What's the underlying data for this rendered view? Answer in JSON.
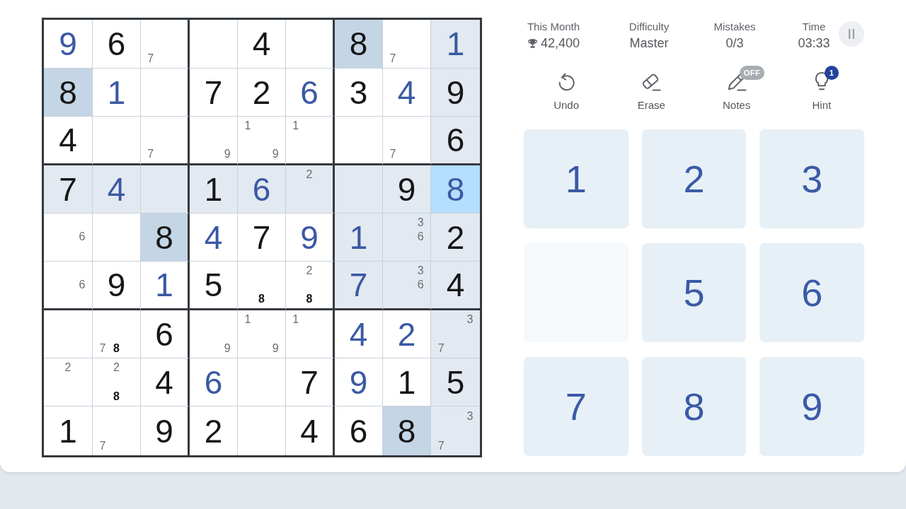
{
  "stats": [
    {
      "kind": "score",
      "label": "This Month",
      "value": "42,400"
    },
    {
      "kind": "plain",
      "label": "Difficulty",
      "value": "Master"
    },
    {
      "kind": "plain",
      "label": "Mistakes",
      "value": "0/3"
    },
    {
      "kind": "timer",
      "label": "Time",
      "value": "03:33"
    }
  ],
  "tools": [
    {
      "kind": "undo",
      "label": "Undo"
    },
    {
      "kind": "erase",
      "label": "Erase"
    },
    {
      "kind": "notes",
      "label": "Notes",
      "badge": "OFF"
    },
    {
      "kind": "hint",
      "label": "Hint",
      "badge": "1"
    }
  ],
  "numpad": [
    {
      "label": "1",
      "disabled": false
    },
    {
      "label": "2",
      "disabled": false
    },
    {
      "label": "3",
      "disabled": false
    },
    {
      "disabled": true
    },
    {
      "label": "5",
      "disabled": false
    },
    {
      "label": "6",
      "disabled": false
    },
    {
      "label": "7",
      "disabled": false
    },
    {
      "label": "8",
      "disabled": false
    },
    {
      "label": "9",
      "disabled": false
    }
  ],
  "board": {
    "rows": [
      {
        "cells": [
          {
            "kind": "entered",
            "value": "9",
            "selected": false,
            "same_number": false,
            "related": false
          },
          {
            "kind": "given",
            "value": "6",
            "selected": false,
            "same_number": false,
            "related": false
          },
          {
            "kind": "notes",
            "notes": [
              {
                "text": "7",
                "match": false
              }
            ],
            "selected": false,
            "same_number": false,
            "related": false
          },
          {
            "kind": "empty",
            "selected": false,
            "same_number": false,
            "related": false
          },
          {
            "kind": "given",
            "value": "4",
            "selected": false,
            "same_number": false,
            "related": false
          },
          {
            "kind": "empty",
            "selected": false,
            "same_number": false,
            "related": false
          },
          {
            "kind": "given",
            "value": "8",
            "selected": false,
            "same_number": true,
            "related": false
          },
          {
            "kind": "notes",
            "notes": [
              {
                "text": "7",
                "match": false
              }
            ],
            "selected": false,
            "same_number": false,
            "related": false
          },
          {
            "kind": "entered",
            "value": "1",
            "selected": false,
            "same_number": false,
            "related": true
          }
        ]
      },
      {
        "cells": [
          {
            "kind": "given",
            "value": "8",
            "selected": false,
            "same_number": true,
            "related": false
          },
          {
            "kind": "entered",
            "value": "1",
            "selected": false,
            "same_number": false,
            "related": false
          },
          {
            "kind": "empty",
            "selected": false,
            "same_number": false,
            "related": false
          },
          {
            "kind": "given",
            "value": "7",
            "selected": false,
            "same_number": false,
            "related": false
          },
          {
            "kind": "given",
            "value": "2",
            "selected": false,
            "same_number": false,
            "related": false
          },
          {
            "kind": "entered",
            "value": "6",
            "selected": false,
            "same_number": false,
            "related": false
          },
          {
            "kind": "given",
            "value": "3",
            "selected": false,
            "same_number": false,
            "related": false
          },
          {
            "kind": "entered",
            "value": "4",
            "selected": false,
            "same_number": false,
            "related": false
          },
          {
            "kind": "given",
            "value": "9",
            "selected": false,
            "same_number": false,
            "related": true
          }
        ]
      },
      {
        "cells": [
          {
            "kind": "given",
            "value": "4",
            "selected": false,
            "same_number": false,
            "related": false
          },
          {
            "kind": "empty",
            "selected": false,
            "same_number": false,
            "related": false
          },
          {
            "kind": "notes",
            "notes": [
              {
                "text": "7",
                "match": false
              }
            ],
            "selected": false,
            "same_number": false,
            "related": false
          },
          {
            "kind": "notes",
            "notes": [
              {
                "text": "9",
                "match": false
              }
            ],
            "selected": false,
            "same_number": false,
            "related": false
          },
          {
            "kind": "notes",
            "notes": [
              {
                "text": "1",
                "match": false
              },
              {
                "text": "9",
                "match": false
              }
            ],
            "selected": false,
            "same_number": false,
            "related": false
          },
          {
            "kind": "notes",
            "notes": [
              {
                "text": "1",
                "match": false
              }
            ],
            "selected": false,
            "same_number": false,
            "related": false
          },
          {
            "kind": "empty",
            "selected": false,
            "same_number": false,
            "related": false
          },
          {
            "kind": "notes",
            "notes": [
              {
                "text": "7",
                "match": false
              }
            ],
            "selected": false,
            "same_number": false,
            "related": false
          },
          {
            "kind": "given",
            "value": "6",
            "selected": false,
            "same_number": false,
            "related": true
          }
        ]
      },
      {
        "cells": [
          {
            "kind": "given",
            "value": "7",
            "selected": false,
            "same_number": false,
            "related": true
          },
          {
            "kind": "entered",
            "value": "4",
            "selected": false,
            "same_number": false,
            "related": true
          },
          {
            "kind": "empty",
            "selected": false,
            "same_number": false,
            "related": true
          },
          {
            "kind": "given",
            "value": "1",
            "selected": false,
            "same_number": false,
            "related": true
          },
          {
            "kind": "entered",
            "value": "6",
            "selected": false,
            "same_number": false,
            "related": true
          },
          {
            "kind": "notes",
            "notes": [
              {
                "text": "2",
                "match": false
              }
            ],
            "selected": false,
            "same_number": false,
            "related": true
          },
          {
            "kind": "empty",
            "selected": false,
            "same_number": false,
            "related": true
          },
          {
            "kind": "given",
            "value": "9",
            "selected": false,
            "same_number": false,
            "related": true
          },
          {
            "kind": "entered",
            "value": "8",
            "selected": true,
            "same_number": false,
            "related": false
          }
        ]
      },
      {
        "cells": [
          {
            "kind": "notes",
            "notes": [
              {
                "text": "6",
                "match": false
              }
            ],
            "selected": false,
            "same_number": false,
            "related": false
          },
          {
            "kind": "empty",
            "selected": false,
            "same_number": false,
            "related": false
          },
          {
            "kind": "given",
            "value": "8",
            "selected": false,
            "same_number": true,
            "related": false
          },
          {
            "kind": "entered",
            "value": "4",
            "selected": false,
            "same_number": false,
            "related": false
          },
          {
            "kind": "given",
            "value": "7",
            "selected": false,
            "same_number": false,
            "related": false
          },
          {
            "kind": "entered",
            "value": "9",
            "selected": false,
            "same_number": false,
            "related": false
          },
          {
            "kind": "entered",
            "value": "1",
            "selected": false,
            "same_number": false,
            "related": true
          },
          {
            "kind": "notes",
            "notes": [
              {
                "text": "3",
                "match": false
              },
              {
                "text": "6",
                "match": false
              }
            ],
            "selected": false,
            "same_number": false,
            "related": true
          },
          {
            "kind": "given",
            "value": "2",
            "selected": false,
            "same_number": false,
            "related": true
          }
        ]
      },
      {
        "cells": [
          {
            "kind": "notes",
            "notes": [
              {
                "text": "6",
                "match": false
              }
            ],
            "selected": false,
            "same_number": false,
            "related": false
          },
          {
            "kind": "given",
            "value": "9",
            "selected": false,
            "same_number": false,
            "related": false
          },
          {
            "kind": "entered",
            "value": "1",
            "selected": false,
            "same_number": false,
            "related": false
          },
          {
            "kind": "given",
            "value": "5",
            "selected": false,
            "same_number": false,
            "related": false
          },
          {
            "kind": "notes",
            "notes": [
              {
                "text": "8",
                "match": true
              }
            ],
            "selected": false,
            "same_number": false,
            "related": false
          },
          {
            "kind": "notes",
            "notes": [
              {
                "text": "2",
                "match": false
              },
              {
                "text": "8",
                "match": true
              }
            ],
            "selected": false,
            "same_number": false,
            "related": false
          },
          {
            "kind": "entered",
            "value": "7",
            "selected": false,
            "same_number": false,
            "related": true
          },
          {
            "kind": "notes",
            "notes": [
              {
                "text": "3",
                "match": false
              },
              {
                "text": "6",
                "match": false
              }
            ],
            "selected": false,
            "same_number": false,
            "related": true
          },
          {
            "kind": "given",
            "value": "4",
            "selected": false,
            "same_number": false,
            "related": true
          }
        ]
      },
      {
        "cells": [
          {
            "kind": "empty",
            "selected": false,
            "same_number": false,
            "related": false
          },
          {
            "kind": "notes",
            "notes": [
              {
                "text": "7",
                "match": false
              },
              {
                "text": "8",
                "match": true
              }
            ],
            "selected": false,
            "same_number": false,
            "related": false
          },
          {
            "kind": "given",
            "value": "6",
            "selected": false,
            "same_number": false,
            "related": false
          },
          {
            "kind": "notes",
            "notes": [
              {
                "text": "9",
                "match": false
              }
            ],
            "selected": false,
            "same_number": false,
            "related": false
          },
          {
            "kind": "notes",
            "notes": [
              {
                "text": "1",
                "match": false
              },
              {
                "text": "9",
                "match": false
              }
            ],
            "selected": false,
            "same_number": false,
            "related": false
          },
          {
            "kind": "notes",
            "notes": [
              {
                "text": "1",
                "match": false
              }
            ],
            "selected": false,
            "same_number": false,
            "related": false
          },
          {
            "kind": "entered",
            "value": "4",
            "selected": false,
            "same_number": false,
            "related": false
          },
          {
            "kind": "entered",
            "value": "2",
            "selected": false,
            "same_number": false,
            "related": false
          },
          {
            "kind": "notes",
            "notes": [
              {
                "text": "3",
                "match": false
              },
              {
                "text": "7",
                "match": false
              }
            ],
            "selected": false,
            "same_number": false,
            "related": true
          }
        ]
      },
      {
        "cells": [
          {
            "kind": "notes",
            "notes": [
              {
                "text": "2",
                "match": false
              }
            ],
            "selected": false,
            "same_number": false,
            "related": false
          },
          {
            "kind": "notes",
            "notes": [
              {
                "text": "2",
                "match": false
              },
              {
                "text": "8",
                "match": true
              }
            ],
            "selected": false,
            "same_number": false,
            "related": false
          },
          {
            "kind": "given",
            "value": "4",
            "selected": false,
            "same_number": false,
            "related": false
          },
          {
            "kind": "entered",
            "value": "6",
            "selected": false,
            "same_number": false,
            "related": false
          },
          {
            "kind": "empty",
            "selected": false,
            "same_number": false,
            "related": false
          },
          {
            "kind": "given",
            "value": "7",
            "selected": false,
            "same_number": false,
            "related": false
          },
          {
            "kind": "entered",
            "value": "9",
            "selected": false,
            "same_number": false,
            "related": false
          },
          {
            "kind": "given",
            "value": "1",
            "selected": false,
            "same_number": false,
            "related": false
          },
          {
            "kind": "given",
            "value": "5",
            "selected": false,
            "same_number": false,
            "related": true
          }
        ]
      },
      {
        "cells": [
          {
            "kind": "given",
            "value": "1",
            "selected": false,
            "same_number": false,
            "related": false
          },
          {
            "kind": "notes",
            "notes": [
              {
                "text": "7",
                "match": false
              }
            ],
            "selected": false,
            "same_number": false,
            "related": false
          },
          {
            "kind": "given",
            "value": "9",
            "selected": false,
            "same_number": false,
            "related": false
          },
          {
            "kind": "given",
            "value": "2",
            "selected": false,
            "same_number": false,
            "related": false
          },
          {
            "kind": "empty",
            "selected": false,
            "same_number": false,
            "related": false
          },
          {
            "kind": "given",
            "value": "4",
            "selected": false,
            "same_number": false,
            "related": false
          },
          {
            "kind": "given",
            "value": "6",
            "selected": false,
            "same_number": false,
            "related": false
          },
          {
            "kind": "given",
            "value": "8",
            "selected": false,
            "same_number": true,
            "related": false
          },
          {
            "kind": "notes",
            "notes": [
              {
                "text": "3",
                "match": false
              },
              {
                "text": "7",
                "match": false
              }
            ],
            "selected": false,
            "same_number": false,
            "related": true
          }
        ]
      }
    ]
  }
}
